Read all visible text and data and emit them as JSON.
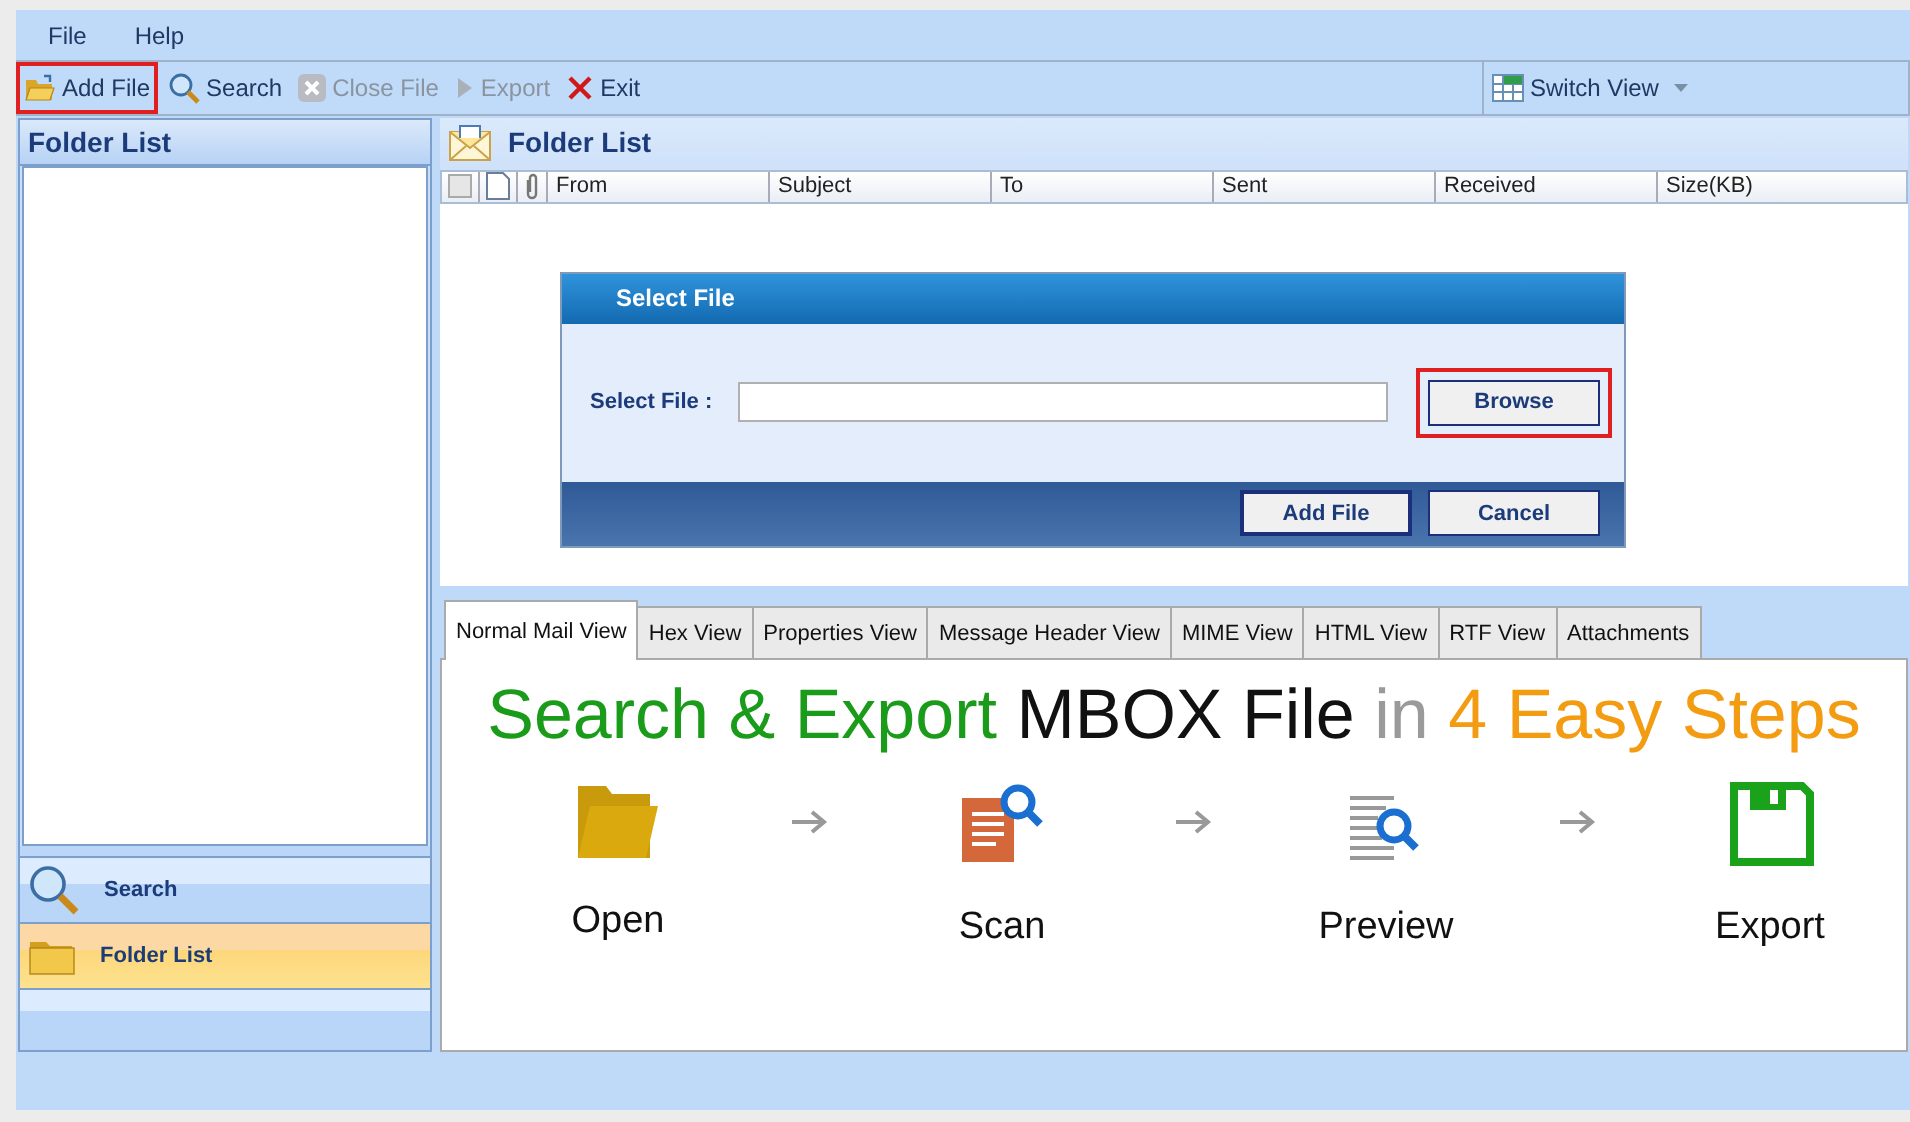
{
  "menu": [
    {
      "label": "File"
    },
    {
      "label": "Help"
    }
  ],
  "toolbar": [
    {
      "label": "Add File",
      "kind": "open",
      "disabled": false,
      "highlighted": true
    },
    {
      "label": "Search",
      "kind": "search",
      "disabled": false,
      "highlighted": false
    },
    {
      "label": "Close File",
      "kind": "close",
      "disabled": true,
      "highlighted": false
    },
    {
      "label": "Export",
      "kind": "play",
      "disabled": true,
      "highlighted": false
    },
    {
      "label": "Exit",
      "kind": "exit",
      "disabled": false,
      "highlighted": false
    }
  ],
  "switch_view": {
    "label": "Switch View"
  },
  "sidebar": {
    "title": "Folder List",
    "nav": [
      {
        "label": "Search",
        "kind": "search",
        "selected": false
      },
      {
        "label": "Folder List",
        "kind": "folder",
        "selected": true
      }
    ]
  },
  "mail_list": {
    "title": "Folder List",
    "columns": [
      "From",
      "Subject",
      "To",
      "Sent",
      "Received",
      "Size(KB)"
    ]
  },
  "dialog": {
    "title": "Select File",
    "field_label": "Select File :",
    "browse": {
      "label": "Browse",
      "highlighted": true
    },
    "buttons": [
      {
        "label": "Add File",
        "default": true
      },
      {
        "label": "Cancel",
        "default": false
      }
    ]
  },
  "tabs": [
    {
      "label": "Normal Mail View",
      "selected": true
    },
    {
      "label": "Hex View",
      "selected": false
    },
    {
      "label": "Properties View",
      "selected": false
    },
    {
      "label": "Message Header View",
      "selected": false
    },
    {
      "label": "MIME View",
      "selected": false
    },
    {
      "label": "HTML View",
      "selected": false
    },
    {
      "label": "RTF View",
      "selected": false
    },
    {
      "label": "Attachments",
      "selected": false
    }
  ],
  "banner": {
    "title": [
      {
        "text": "Search & Export",
        "color": "#1a9c1a"
      },
      {
        "text": "MBOX File",
        "color": "#111111"
      },
      {
        "text": "in",
        "color": "#9a9a9a"
      },
      {
        "text": "4 Easy Steps",
        "color": "#f39c12"
      }
    ],
    "steps": [
      {
        "kind": "open",
        "label": "Open"
      },
      {
        "kind": "scan",
        "label": "Scan"
      },
      {
        "kind": "preview",
        "label": "Preview"
      },
      {
        "kind": "export",
        "label": "Export"
      }
    ]
  }
}
